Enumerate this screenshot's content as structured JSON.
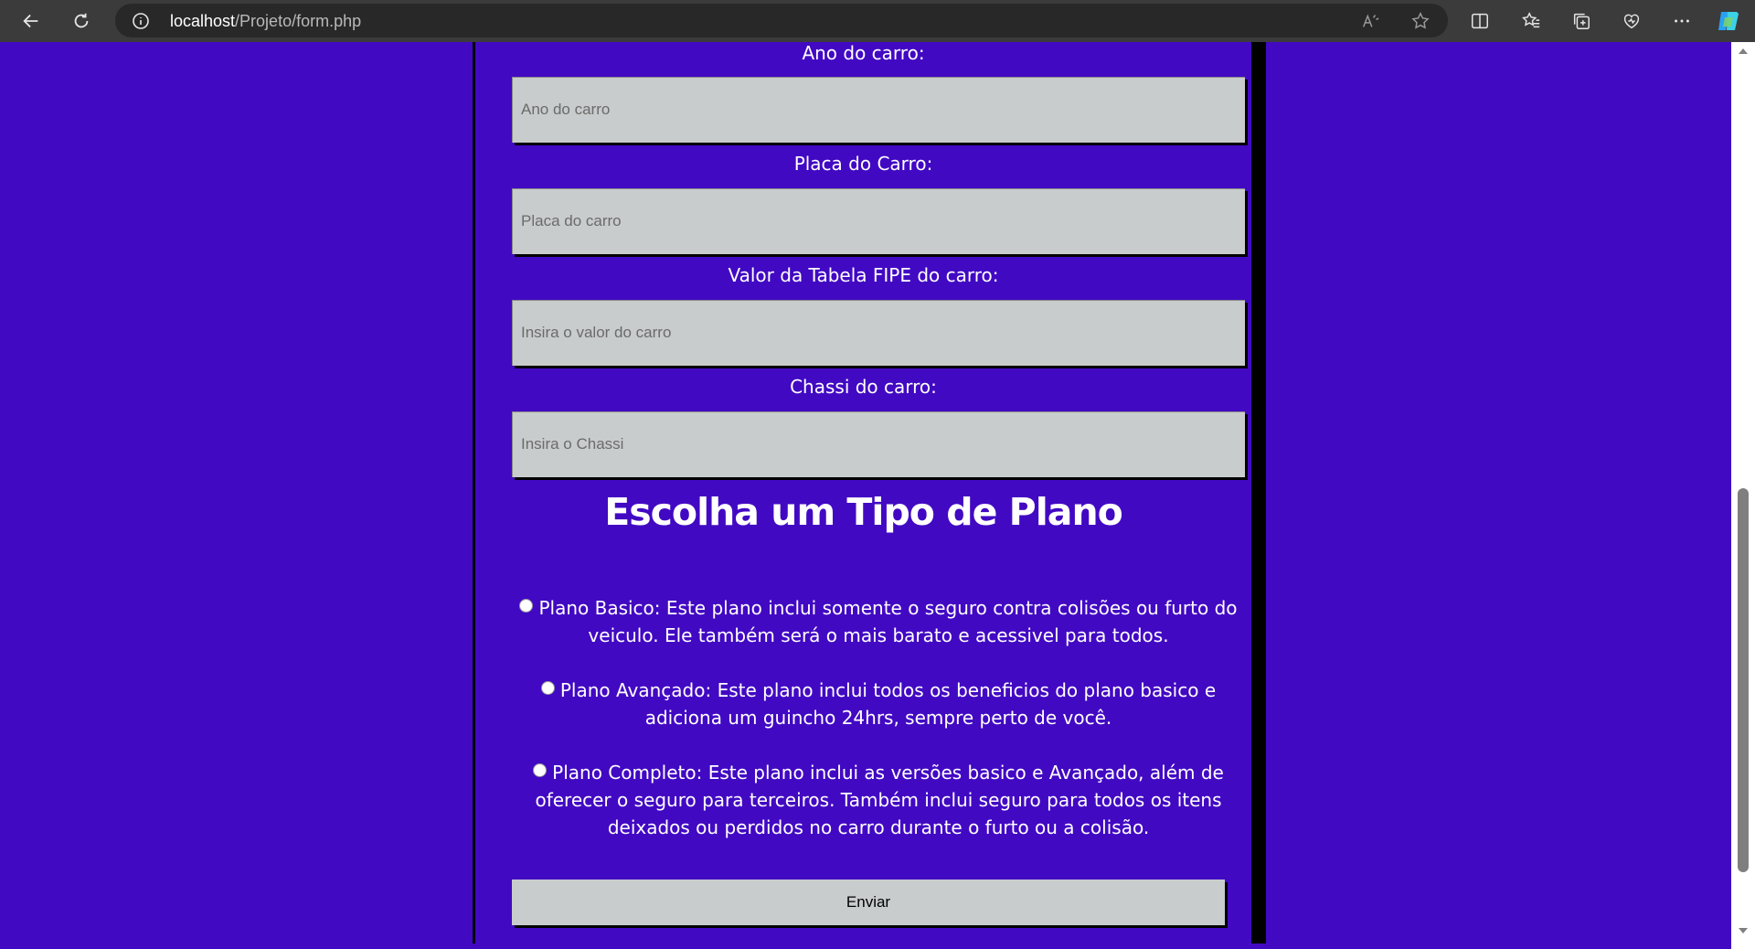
{
  "browser": {
    "url_host": "localhost",
    "url_path": "/Projeto/form.php"
  },
  "form": {
    "fields": [
      {
        "label": "Ano do carro:",
        "placeholder": "Ano do carro"
      },
      {
        "label": "Placa do Carro:",
        "placeholder": "Placa do carro"
      },
      {
        "label": "Valor da Tabela FIPE do carro:",
        "placeholder": "Insira o valor do carro"
      },
      {
        "label": "Chassi do carro:",
        "placeholder": "Insira o Chassi"
      }
    ],
    "plan_title": "Escolha um Tipo de Plano",
    "plans": [
      {
        "text": "Plano Basico: Este plano inclui somente o seguro contra colisões ou furto do veiculo. Ele também será o mais barato e acessivel para todos."
      },
      {
        "text": "Plano Avançado: Este plano inclui todos os beneficios do plano basico e adiciona um guincho 24hrs, sempre perto de você."
      },
      {
        "text": "Plano Completo: Este plano inclui as versões basico e Avançado, além de oferecer o seguro para terceiros. Também inclui seguro para todos os itens deixados ou perdidos no carro durante o furto ou a colisão."
      }
    ],
    "submit_label": "Enviar"
  },
  "colors": {
    "page_background": "#4209c3",
    "input_background": "#c9cccc",
    "border": "#000000",
    "text": "#ffffff"
  },
  "icons": [
    "back-icon",
    "refresh-icon",
    "info-icon",
    "read-aloud-icon",
    "favorite-star-icon",
    "split-screen-icon",
    "favorites-icon",
    "collections-icon",
    "browser-essentials-icon",
    "more-icon",
    "copilot-icon"
  ]
}
